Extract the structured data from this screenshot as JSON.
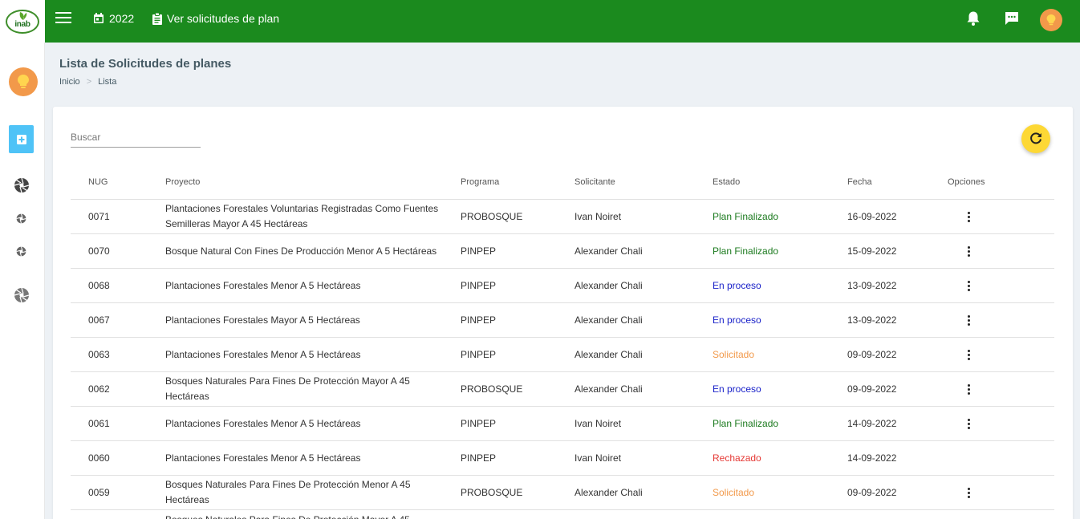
{
  "brand": {
    "logo_text": "inab"
  },
  "topbar": {
    "year": "2022",
    "plan_link": "Ver solicitudes de plan"
  },
  "header": {
    "title": "Lista de Solicitudes de planes",
    "breadcrumb": [
      "Inicio",
      "Lista"
    ]
  },
  "search": {
    "placeholder": "Buscar"
  },
  "table": {
    "headers": [
      "NUG",
      "Proyecto",
      "Programa",
      "Solicitante",
      "Estado",
      "Fecha",
      "Opciones"
    ],
    "rows": [
      {
        "nug": "0071",
        "proyecto": "Plantaciones Forestales Voluntarias Registradas Como Fuentes Semilleras Mayor A 45 Hectáreas",
        "programa": "PROBOSQUE",
        "solicitante": "Ivan Noiret",
        "estado": "Plan Finalizado",
        "fecha": "16-09-2022",
        "options": true
      },
      {
        "nug": "0070",
        "proyecto": "Bosque Natural Con Fines De Producción Menor A 5 Hectáreas",
        "programa": "PINPEP",
        "solicitante": "Alexander Chali",
        "estado": "Plan Finalizado",
        "fecha": "15-09-2022",
        "options": true
      },
      {
        "nug": "0068",
        "proyecto": "Plantaciones Forestales Menor A 5 Hectáreas",
        "programa": "PINPEP",
        "solicitante": "Alexander Chali",
        "estado": "En proceso",
        "fecha": "13-09-2022",
        "options": true
      },
      {
        "nug": "0067",
        "proyecto": "Plantaciones Forestales Mayor A 5 Hectáreas",
        "programa": "PINPEP",
        "solicitante": "Alexander Chali",
        "estado": "En proceso",
        "fecha": "13-09-2022",
        "options": true
      },
      {
        "nug": "0063",
        "proyecto": "Plantaciones Forestales Menor A 5 Hectáreas",
        "programa": "PINPEP",
        "solicitante": "Alexander Chali",
        "estado": "Solicitado",
        "fecha": "09-09-2022",
        "options": true
      },
      {
        "nug": "0062",
        "proyecto": "Bosques Naturales Para Fines De Protección Mayor A 45 Hectáreas",
        "programa": "PROBOSQUE",
        "solicitante": "Alexander Chali",
        "estado": "En proceso",
        "fecha": "09-09-2022",
        "options": true
      },
      {
        "nug": "0061",
        "proyecto": "Plantaciones Forestales Menor A 5 Hectáreas",
        "programa": "PINPEP",
        "solicitante": "Ivan Noiret",
        "estado": "Plan Finalizado",
        "fecha": "14-09-2022",
        "options": true
      },
      {
        "nug": "0060",
        "proyecto": "Plantaciones Forestales Menor A 5 Hectáreas",
        "programa": "PINPEP",
        "solicitante": "Ivan Noiret",
        "estado": "Rechazado",
        "fecha": "14-09-2022",
        "options": false
      },
      {
        "nug": "0059",
        "proyecto": "Bosques Naturales Para Fines De Protección Menor A 45 Hectáreas",
        "programa": "PROBOSQUE",
        "solicitante": "Alexander Chali",
        "estado": "Solicitado",
        "fecha": "09-09-2022",
        "options": true
      },
      {
        "nug": "",
        "proyecto": "Bosques Naturales Para Fines De Protección Mayor A 45",
        "programa": "",
        "solicitante": "",
        "estado": "",
        "fecha": "",
        "options": false
      }
    ]
  },
  "colors": {
    "topbar": "#1b8a1e",
    "status_finalizado": "#1b7a1e",
    "status_en_proceso": "#1a22c9",
    "status_solicitado": "#f2994a",
    "status_rechazado": "#e53935",
    "refresh_button": "#fdd835",
    "add_button": "#4fc3f7",
    "avatar": "#f2994a"
  },
  "icons": {
    "menu": "menu-icon",
    "calendar": "calendar-icon",
    "clipboard": "clipboard-icon",
    "bell": "bell-icon",
    "chat": "chat-icon",
    "avatar": "lightbulb-avatar",
    "add": "add-box-icon",
    "aperture": "aperture-icon",
    "refresh": "refresh-icon",
    "options": "more-vert-icon"
  }
}
